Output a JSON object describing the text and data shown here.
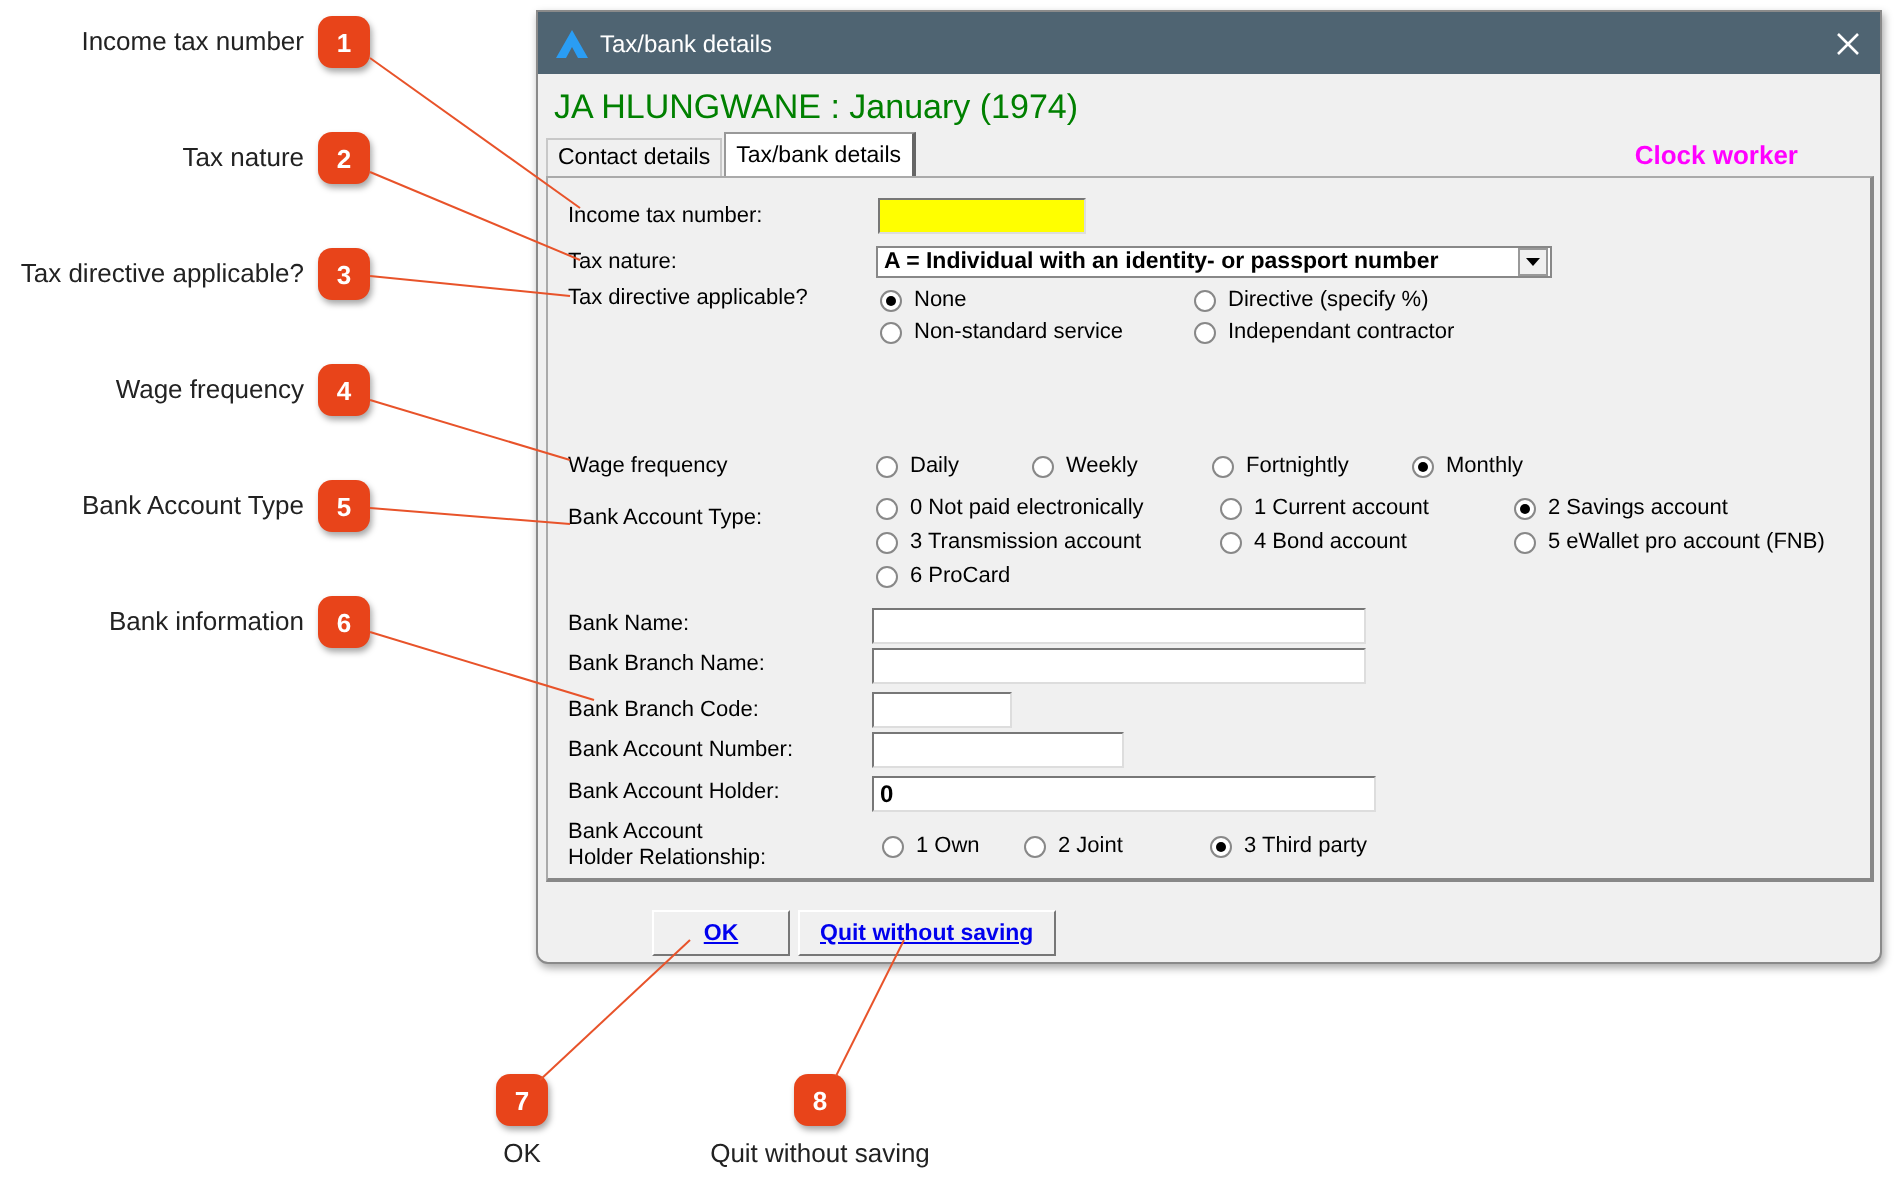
{
  "side_callouts": [
    {
      "number": "1",
      "label": "Income tax number"
    },
    {
      "number": "2",
      "label": "Tax nature"
    },
    {
      "number": "3",
      "label": "Tax directive applicable?"
    },
    {
      "number": "4",
      "label": "Wage frequency"
    },
    {
      "number": "5",
      "label": "Bank Account Type"
    },
    {
      "number": "6",
      "label": "Bank information"
    }
  ],
  "window": {
    "title": "Tax/bank details"
  },
  "heading": "JA HLUNGWANE : January (1974)",
  "tabs": [
    {
      "label": "Contact details",
      "selected": false
    },
    {
      "label": "Tax/bank details",
      "selected": true
    }
  ],
  "worker_type": "Clock worker",
  "rows": [
    {
      "kind": "text",
      "label": "Income tax number:",
      "highlighted": true
    },
    {
      "kind": "select",
      "label": "Tax nature:",
      "value": "A = Individual with an identity- or passport number"
    },
    {
      "kind": "radio",
      "label": "Tax directive applicable?",
      "options": [
        {
          "label": "None",
          "selected": true
        },
        {
          "label": "Directive (specify %)",
          "selected": false
        },
        {
          "label": "Non-standard service",
          "selected": false
        },
        {
          "label": "Independant contractor",
          "selected": false
        }
      ]
    },
    {
      "kind": "radio",
      "label": "Wage frequency",
      "options": [
        {
          "label": "Daily",
          "selected": false
        },
        {
          "label": "Weekly",
          "selected": false
        },
        {
          "label": "Fortnightly",
          "selected": false
        },
        {
          "label": "Monthly",
          "selected": true
        }
      ]
    },
    {
      "kind": "radio",
      "label": "Bank Account Type:",
      "options": [
        {
          "label": "0 Not paid electronically",
          "selected": false
        },
        {
          "label": "1 Current account",
          "selected": false
        },
        {
          "label": "2 Savings account",
          "selected": true
        },
        {
          "label": "3 Transmission account",
          "selected": false
        },
        {
          "label": "4 Bond account",
          "selected": false
        },
        {
          "label": "5 eWallet pro account (FNB)",
          "selected": false
        },
        {
          "label": "6 ProCard",
          "selected": false
        }
      ]
    },
    {
      "kind": "text",
      "label": "Bank Name:",
      "highlighted": false
    },
    {
      "kind": "text",
      "label": "Bank Branch Name:",
      "highlighted": false
    },
    {
      "kind": "text",
      "label": "Bank Branch Code:",
      "highlighted": false
    },
    {
      "kind": "text",
      "label": "Bank Account Number:",
      "highlighted": false
    },
    {
      "kind": "text",
      "label": "Bank Account Holder:",
      "highlighted": false,
      "value": "0"
    },
    {
      "kind": "radio",
      "label": "Bank Account\nHolder Relationship:",
      "options": [
        {
          "label": "1 Own",
          "selected": false
        },
        {
          "label": "2 Joint",
          "selected": false
        },
        {
          "label": "3 Third party",
          "selected": true
        }
      ]
    }
  ],
  "buttons": [
    "OK",
    "Quit without saving"
  ],
  "bottom_callouts": [
    {
      "number": "7",
      "label": "OK"
    },
    {
      "number": "8",
      "label": "Quit without saving"
    }
  ]
}
